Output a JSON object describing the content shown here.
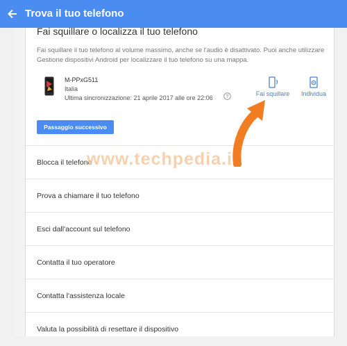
{
  "appbar": {
    "title": "Trova il tuo telefono",
    "back_icon": "arrow-left-icon"
  },
  "section": {
    "title": "Fai squillare o localizza il tuo telefono",
    "description": "Fai squillare il tuo telefono al volume massimo, anche se l'audio è disattivato. Puoi anche utilizzare Gestione dispositivi Android per localizzare il tuo telefono su una mappa."
  },
  "device": {
    "name": "M-PPxG511",
    "country": "Italia",
    "last_sync": "Ultima sincronizzazione: 21 aprile 2017 alle ore 22:06"
  },
  "actions": {
    "ring_label": "Fai squillare",
    "locate_label": "Individua"
  },
  "next_button": "Passaggio successivo",
  "options": [
    "Blocca il telefono",
    "Prova a chiamare il tuo telefono",
    "Esci dall'account sul telefono",
    "Contatta il tuo operatore",
    "Contatta l'assistenza locale",
    "Valuta la possibilità di resettare il dispositivo"
  ],
  "watermark": "www.techpedia.it",
  "colors": {
    "appbar": "#4a8cf0",
    "link": "#4a7fd0",
    "arrow": "#f07d22"
  }
}
